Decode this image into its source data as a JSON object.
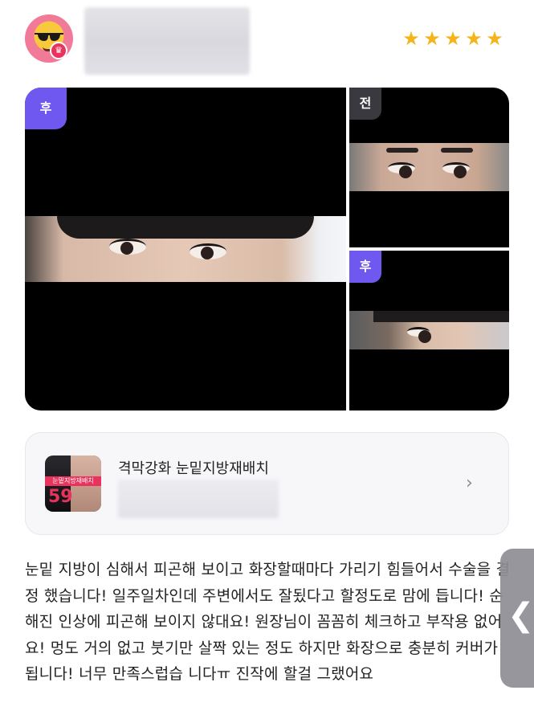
{
  "header": {
    "avatar_icon": "sunglasses-emoji-icon",
    "badge_icon": "crown-icon",
    "rating_stars": 5,
    "star_char": "★",
    "star_color": "#f5b41a"
  },
  "photos": {
    "main_tag": "후",
    "top_tag": "전",
    "bottom_tag": "후",
    "tag_after_color": "#6f58f0",
    "tag_before_color": "#3a3940"
  },
  "product": {
    "title": "격막강화 눈밑지방재배치",
    "thumb_band": "눈밑지방재배치",
    "thumb_price": "59",
    "chevron": "›"
  },
  "review": {
    "text": "눈밑 지방이 심해서 피곤해 보이고 화장할때마다 가리기 힘들어서 수술을 결정 했습니다! 일주일차인데 주변에서도 잘됬다고 할정도로 맘에 듭니다! 순해진 인상에 피곤해 보이지 않대요! 원장님이 꼼꼼히 체크하고 부작용 없어요! 멍도 거의 없고 붓기만 살짝 있는 정도 하지만 화장으로 충분히 커버가 됩니다! 너무 만족스럽습 니다ㅠ 진작에 할걸 그랬어요"
  },
  "side_handle": {
    "label": "❮"
  }
}
